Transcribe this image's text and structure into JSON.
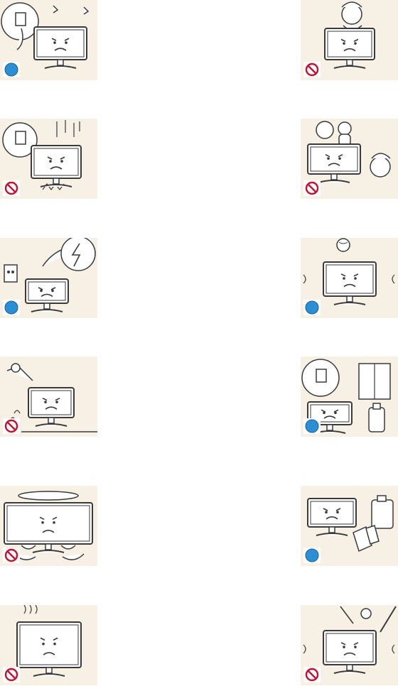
{
  "colors": {
    "card_background": "#f6f1e4",
    "line_art": "#3a3a3a",
    "do_badge": "#2b8fd6",
    "dont_badge": "#c8102e"
  },
  "cards": [
    {
      "id": "tv-unplug-thunder",
      "badge": "do",
      "icon": "tv-with-plug-icon"
    },
    {
      "id": "child-climbing-tv",
      "badge": "dont",
      "icon": "child-on-tv-icon"
    },
    {
      "id": "tv-falling-plug",
      "badge": "dont",
      "icon": "falling-tv-icon"
    },
    {
      "id": "toys-on-tv",
      "badge": "dont",
      "icon": "toys-on-tv-icon"
    },
    {
      "id": "unplug-during-storm",
      "badge": "do",
      "icon": "storm-unplug-icon"
    },
    {
      "id": "ball-hits-tv",
      "badge": "do",
      "icon": "ball-tv-icon"
    },
    {
      "id": "tv-tipping-over",
      "badge": "dont",
      "icon": "tipping-tv-icon"
    },
    {
      "id": "ventilate-gas-leak",
      "badge": "do",
      "icon": "ventilation-icon"
    },
    {
      "id": "rotating-tv-hands",
      "badge": "dont",
      "icon": "spinning-tv-icon"
    },
    {
      "id": "keep-chemicals-away",
      "badge": "do",
      "icon": "chemicals-icon"
    },
    {
      "id": "covered-tv-heat",
      "badge": "dont",
      "icon": "covered-tv-icon"
    },
    {
      "id": "metal-objects-tv",
      "badge": "dont",
      "icon": "metal-objects-icon"
    }
  ]
}
